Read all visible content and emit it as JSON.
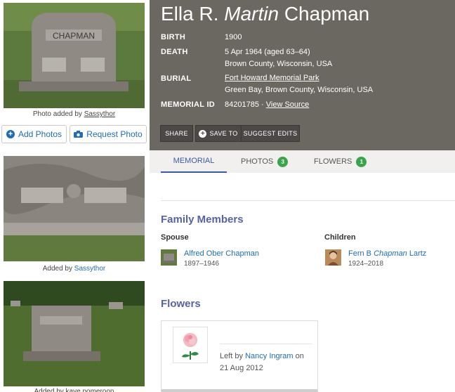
{
  "left": {
    "photo1_caption_prefix": "Photo added by",
    "photo1_caption_user": "Sassythor",
    "add_photos": "Add Photos",
    "request_photo": "Request Photo",
    "photo2_caption_prefix": "Added by",
    "photo2_caption_user": "Sassythor",
    "photo3_caption": "Added by kaye pomeroon"
  },
  "memorial": {
    "name_first": "Ella R.",
    "name_maiden": "Martin",
    "name_last": "Chapman",
    "birth_label": "BIRTH",
    "birth_value": "1900",
    "death_label": "DEATH",
    "death_value": "5 Apr 1964 (aged 63–64)",
    "death_place": "Brown County, Wisconsin, USA",
    "burial_label": "BURIAL",
    "burial_cemetery": "Fort Howard Memorial Park",
    "burial_place": "Green Bay, Brown County, Wisconsin, USA",
    "id_label": "MEMORIAL ID",
    "id_value": "84201785",
    "id_sep": "·",
    "view_source": "View Source"
  },
  "actions": {
    "share": "SHARE",
    "save_to": "SAVE TO",
    "suggest_edits": "SUGGEST EDITS"
  },
  "tabs": {
    "memorial": "MEMORIAL",
    "photos": "PHOTOS",
    "photos_count": "3",
    "flowers": "FLOWERS",
    "flowers_count": "1"
  },
  "family": {
    "heading": "Family Members",
    "spouse_heading": "Spouse",
    "spouse_name": "Alfred Ober Chapman",
    "spouse_years": "1897–1946",
    "children_heading": "Children",
    "child_first": "Fern B",
    "child_maiden": "Chapman",
    "child_last": "Lartz",
    "child_years": "1924–2018"
  },
  "flowers": {
    "heading": "Flowers",
    "left_by_prefix": "Left by",
    "left_by_user": "Nancy Ingram",
    "left_by_on": "on",
    "date": "21 Aug 2012"
  },
  "icons": {
    "add_photos": "plus-circle-icon",
    "request_photo": "camera-icon",
    "save_to": "plus-circle-icon",
    "flower": "pink-rose-icon"
  },
  "colors": {
    "header_bg": "#6b6761",
    "link": "#1f6db4",
    "section_heading": "#5562a4",
    "badge": "#3aa44a"
  }
}
